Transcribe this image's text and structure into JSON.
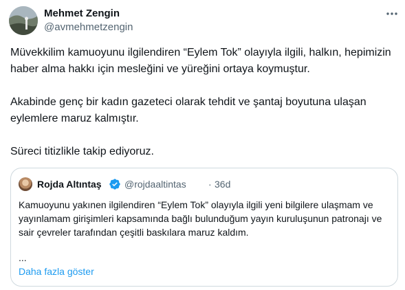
{
  "author": {
    "name": "Mehmet Zengin",
    "handle": "@avmehmetzengin",
    "avatar_icon": "profile-photo"
  },
  "menu": {
    "icon": "more-horizontal-icon"
  },
  "tweet": {
    "paragraphs": [
      "Müvekkilim kamuoyunu ilgilendiren “Eylem Tok” olayıyla ilgili, halkın, hepimizin haber alma hakkı için mesleğini ve yüreğini ortaya koymuştur.",
      "Akabinde genç bir kadın gazeteci olarak tehdit ve şantaj boyutuna ulaşan eylemlere maruz kalmıştır.",
      "Süreci titizlikle takip ediyoruz."
    ]
  },
  "quoted": {
    "name": "Rojda Altıntaş",
    "verified": true,
    "handle": "@rojdaaltintas",
    "separator": "·",
    "time": "36d",
    "text": "Kamuoyunu yakınen ilgilendiren “Eylem Tok” olayıyla ilgili yeni bilgilere ulaşmam ve yayınlamam girişimleri kapsamında bağlı bulunduğum yayın kuruluşunun patronajı ve sair çevreler tarafından çeşitli baskılara maruz kaldım.",
    "ellipsis": "...",
    "show_more": "Daha fazla göster"
  },
  "colors": {
    "accent": "#1d9bf0",
    "text": "#0f1419",
    "secondary": "#536471",
    "border": "#cfd9de"
  }
}
